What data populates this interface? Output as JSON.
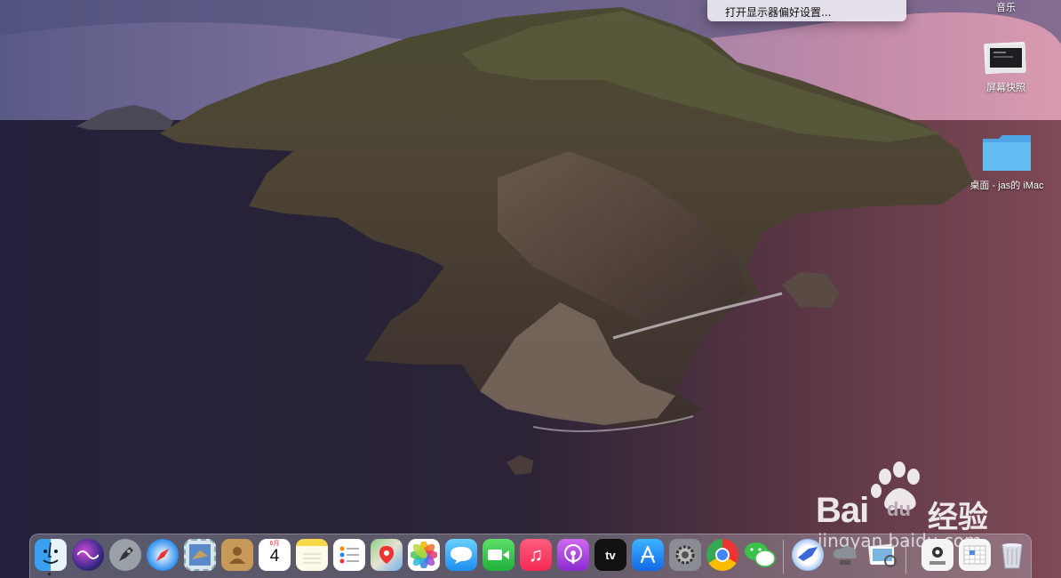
{
  "context_menu": {
    "items": [
      "打开显示器偏好设置..."
    ]
  },
  "desktop": {
    "icons": [
      {
        "label": "音乐",
        "icon": "music-folder-icon"
      },
      {
        "label": "屏幕快照",
        "icon": "screenshot-thumbnail-icon"
      },
      {
        "label": "桌面 - jas的 iMac",
        "icon": "folder-icon"
      }
    ]
  },
  "dock": {
    "calendar": {
      "month": "6月",
      "day": "4"
    },
    "appletv_label": "tv",
    "apps": [
      "finder",
      "siri",
      "launchpad",
      "safari",
      "mail-stamp",
      "contacts",
      "calendar",
      "notes",
      "reminders",
      "maps",
      "photos",
      "messages",
      "facetime",
      "music",
      "podcasts",
      "appletv",
      "app-store",
      "system-preferences",
      "chrome",
      "wechat",
      "feishu",
      "network-drive",
      "preview",
      "config",
      "grid-app",
      "trash"
    ]
  },
  "watermark": {
    "brand": "Bai",
    "brand_paw": "du",
    "cn": "经验",
    "url": "jingyan.baidu.com"
  }
}
